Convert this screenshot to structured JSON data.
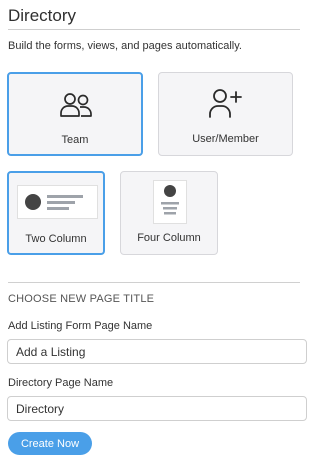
{
  "header": {
    "title": "Directory",
    "subtitle": "Build the forms, views, and pages automatically."
  },
  "type_options": [
    {
      "label": "Team",
      "icon": "team-icon",
      "selected": true
    },
    {
      "label": "User/Member",
      "icon": "user-add-icon",
      "selected": false
    }
  ],
  "layout_options": [
    {
      "label": "Two Column",
      "icon": "two-column-layout-icon",
      "selected": true
    },
    {
      "label": "Four Column",
      "icon": "four-column-layout-icon",
      "selected": false
    }
  ],
  "section": {
    "heading": "CHOOSE NEW PAGE TITLE"
  },
  "fields": {
    "listing_label": "Add Listing Form Page Name",
    "listing_value": "Add a Listing",
    "directory_label": "Directory Page Name",
    "directory_value": "Directory"
  },
  "actions": {
    "create_label": "Create Now"
  },
  "colors": {
    "accent": "#4a9fe8",
    "card_bg": "#f5f5f7",
    "border": "#d7d7db"
  }
}
